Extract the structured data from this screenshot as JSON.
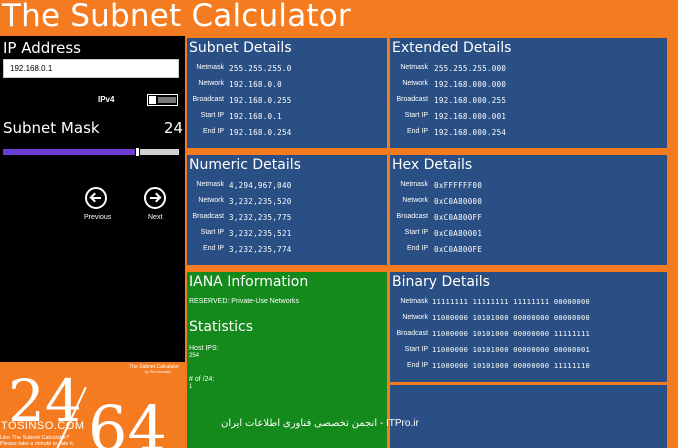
{
  "app": {
    "title": "The Subnet Calculator"
  },
  "left": {
    "ip_label": "IP Address",
    "ip_value": "192.168.0.1",
    "ipv4_label": "IPv4",
    "mask_label": "Subnet Mask",
    "mask_value": "24",
    "slider_fraction": 0.75,
    "prev_label": "Previous",
    "next_label": "Next"
  },
  "subnet_details": {
    "title": "Subnet Details",
    "rows": [
      {
        "label": "Netmask",
        "value": "255.255.255.0"
      },
      {
        "label": "Network",
        "value": "192.168.0.0"
      },
      {
        "label": "Broadcast",
        "value": "192.168.0.255"
      },
      {
        "label": "Start IP",
        "value": "192.168.0.1"
      },
      {
        "label": "End IP",
        "value": "192.168.0.254"
      }
    ]
  },
  "extended_details": {
    "title": "Extended Details",
    "rows": [
      {
        "label": "Netmask",
        "value": "255.255.255.000"
      },
      {
        "label": "Network",
        "value": "192.168.000.000"
      },
      {
        "label": "Broadcast",
        "value": "192.168.000.255"
      },
      {
        "label": "Start IP",
        "value": "192.168.000.001"
      },
      {
        "label": "End IP",
        "value": "192.168.000.254"
      }
    ]
  },
  "numeric_details": {
    "title": "Numeric Details",
    "rows": [
      {
        "label": "Netmask",
        "value": "4,294,967,040"
      },
      {
        "label": "Network",
        "value": "3,232,235,520"
      },
      {
        "label": "Broadcast",
        "value": "3,232,235,775"
      },
      {
        "label": "Start IP",
        "value": "3,232,235,521"
      },
      {
        "label": "End IP",
        "value": "3,232,235,774"
      }
    ]
  },
  "hex_details": {
    "title": "Hex Details",
    "rows": [
      {
        "label": "Netmask",
        "value": "0xFFFFFF00"
      },
      {
        "label": "Network",
        "value": "0xC0A80000"
      },
      {
        "label": "Broadcast",
        "value": "0xC0A800FF"
      },
      {
        "label": "Start IP",
        "value": "0xC0A80001"
      },
      {
        "label": "End IP",
        "value": "0xC0A800FE"
      }
    ]
  },
  "iana": {
    "title": "IANA Information",
    "info": "RESERVED: Private-Use Networks",
    "stats_title": "Statistics",
    "host_ips_label": "Host IPS:",
    "host_ips_value": "254",
    "count_label": "# of /24:",
    "count_value": "1"
  },
  "binary_details": {
    "title": "Binary Details",
    "rows": [
      {
        "label": "Netmask",
        "value": "11111111 11111111 11111111 00000000"
      },
      {
        "label": "Network",
        "value": "11000000 10101000 00000000 00000000"
      },
      {
        "label": "Broadcast",
        "value": "11000000 10101000 00000000 11111111"
      },
      {
        "label": "Start IP",
        "value": "11000000 10101000 00000000 00000001"
      },
      {
        "label": "End IP",
        "value": "11000000 10101000 00000000 11111110"
      }
    ]
  },
  "splash": {
    "title": "The Subnet Calculator",
    "subtitle": "by The Innovator",
    "big_left": "24",
    "big_right": "64",
    "review_line1": "Like The Subnet Calculator?",
    "review_line2": "Please take a minute to rate it."
  },
  "watermarks": {
    "left": "TOSINSO.COM",
    "middle": "انجمن تخصصی فناوری اطلاعات ایران - ITPro.ir"
  },
  "colors": {
    "accent_orange": "#f47b20",
    "tile_blue": "#2a4f84",
    "tile_green": "#14891c",
    "slider_purple": "#6b3fd6"
  }
}
